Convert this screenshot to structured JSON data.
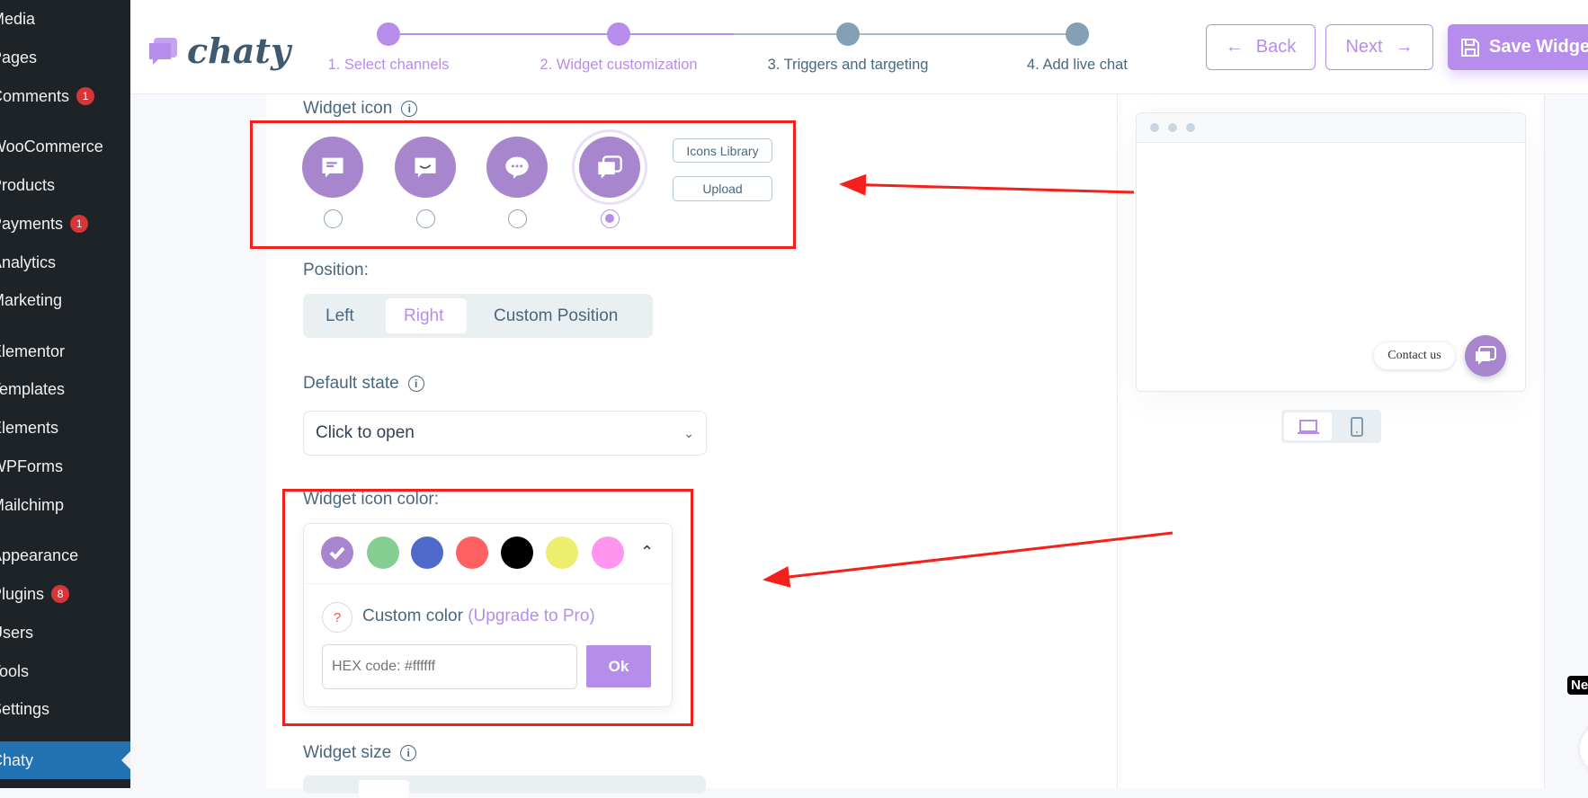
{
  "sidebar": {
    "items": [
      {
        "label": "Media"
      },
      {
        "label": "Pages"
      },
      {
        "label": "Comments",
        "badge": "1"
      },
      {
        "label": "WooCommerce"
      },
      {
        "label": "Products"
      },
      {
        "label": "Payments",
        "badge": "1"
      },
      {
        "label": "Analytics"
      },
      {
        "label": "Marketing"
      },
      {
        "label": "Elementor"
      },
      {
        "label": "Templates"
      },
      {
        "label": "Elements"
      },
      {
        "label": "WPForms"
      },
      {
        "label": "Mailchimp"
      },
      {
        "label": "Appearance"
      },
      {
        "label": "Plugins",
        "badge": "8"
      },
      {
        "label": "Users"
      },
      {
        "label": "Tools"
      },
      {
        "label": "Settings"
      },
      {
        "label": "Chaty"
      }
    ]
  },
  "header": {
    "logo": "chaty",
    "steps": [
      {
        "label": "1. Select channels",
        "state": "done"
      },
      {
        "label": "2. Widget customization",
        "state": "active"
      },
      {
        "label": "3. Triggers and targeting",
        "state": "todo"
      },
      {
        "label": "4. Add live chat",
        "state": "todo"
      }
    ],
    "back_label": "Back",
    "next_label": "Next",
    "save_label": "Save Widget"
  },
  "widget_icon": {
    "label": "Widget icon",
    "icons": [
      "chat-lines-icon",
      "chat-smile-icon",
      "chat-dots-icon",
      "chat-double-icon"
    ],
    "selected_index": 3,
    "library_label": "Icons Library",
    "upload_label": "Upload"
  },
  "position": {
    "label": "Position:",
    "options": [
      "Left",
      "Right",
      "Custom Position"
    ],
    "selected": "Right"
  },
  "default_state": {
    "label": "Default state",
    "value": "Click to open"
  },
  "icon_color": {
    "label": "Widget icon color:",
    "swatches": [
      "#a886cd",
      "#86cd91",
      "#4f6aca",
      "#ff6060",
      "#000000",
      "#eeee6e",
      "#ff95ee"
    ],
    "selected_index": 0,
    "custom_label": "Custom color",
    "upgrade_label": "(Upgrade to Pro)",
    "hex_placeholder": "HEX code: #ffffff",
    "ok_label": "Ok"
  },
  "widget_size": {
    "label": "Widget size"
  },
  "preview": {
    "contact_label": "Contact us"
  },
  "misc": {
    "badge_fragment": "Ne"
  },
  "colors": {
    "accent": "#b78deb",
    "icon": "#a886cd",
    "text": "#49687e",
    "annotation": "#f5201b"
  }
}
